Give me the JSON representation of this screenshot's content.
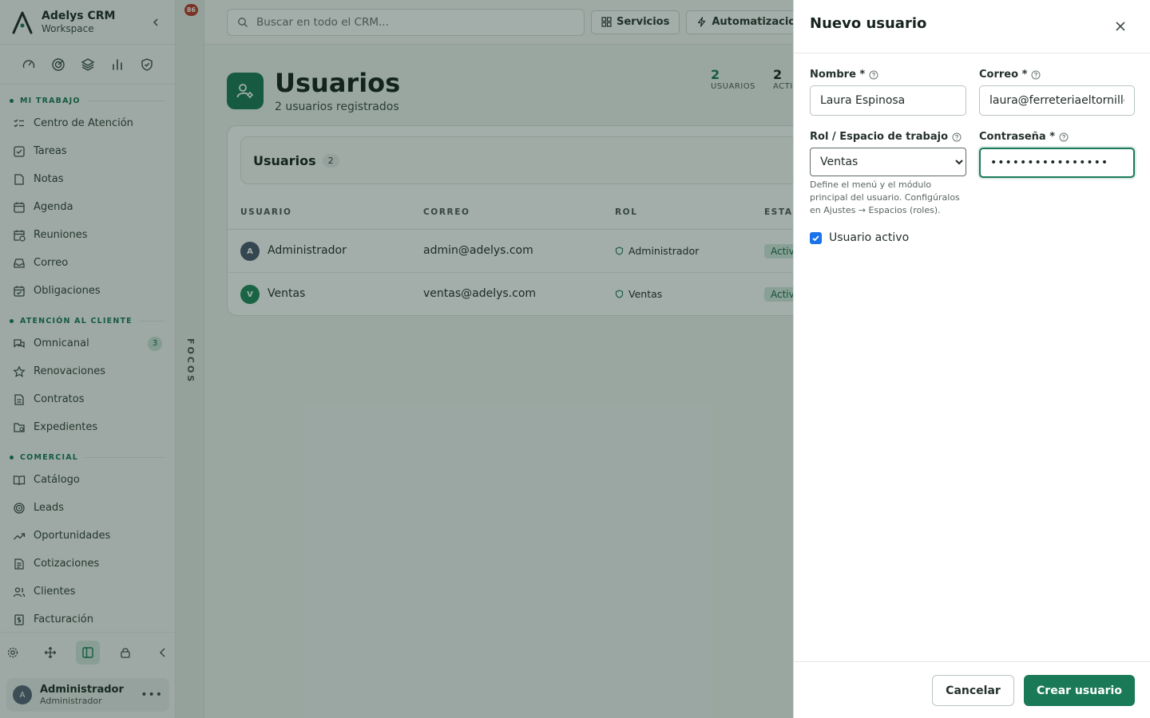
{
  "app": {
    "name": "Adelys CRM",
    "workspace": "Workspace"
  },
  "sidebar": {
    "sections": [
      {
        "label": "MI TRABAJO",
        "items": [
          {
            "label": "Centro de Atención",
            "icon": "list-check-icon"
          },
          {
            "label": "Tareas",
            "icon": "checkbox-icon"
          },
          {
            "label": "Notas",
            "icon": "note-icon"
          },
          {
            "label": "Agenda",
            "icon": "calendar-icon"
          },
          {
            "label": "Reuniones",
            "icon": "calendar-clock-icon"
          },
          {
            "label": "Correo",
            "icon": "inbox-icon"
          },
          {
            "label": "Obligaciones",
            "icon": "calendar-check-icon"
          }
        ]
      },
      {
        "label": "ATENCIÓN AL CLIENTE",
        "items": [
          {
            "label": "Omnicanal",
            "icon": "chat-icon",
            "badge": "3"
          },
          {
            "label": "Renovaciones",
            "icon": "star-icon"
          },
          {
            "label": "Contratos",
            "icon": "document-icon"
          },
          {
            "label": "Expedientes",
            "icon": "folder-icon"
          }
        ]
      },
      {
        "label": "COMERCIAL",
        "items": [
          {
            "label": "Catálogo",
            "icon": "book-icon"
          },
          {
            "label": "Leads",
            "icon": "target-icon"
          },
          {
            "label": "Oportunidades",
            "icon": "trend-icon"
          },
          {
            "label": "Cotizaciones",
            "icon": "quote-icon"
          },
          {
            "label": "Clientes",
            "icon": "users-icon"
          },
          {
            "label": "Facturación",
            "icon": "invoice-icon"
          }
        ]
      }
    ],
    "user": {
      "initial": "A",
      "name": "Administrador",
      "role": "Administrador"
    }
  },
  "focus": {
    "badge": "86",
    "label": "FOCOS"
  },
  "topbar": {
    "search_placeholder": "Buscar en todo el CRM...",
    "services_label": "Servicios",
    "automations_label": "Automatizacion"
  },
  "page": {
    "title": "Usuarios",
    "subtitle": "2 usuarios registrados",
    "stats": [
      {
        "value": "2",
        "label": "USUARIOS",
        "color": "#1a7a57"
      },
      {
        "value": "2",
        "label": "ACTI",
        "color": "#17231e"
      }
    ]
  },
  "users_table": {
    "title": "Usuarios",
    "count": "2",
    "columns": [
      "USUARIO",
      "CORREO",
      "ROL",
      "ESTA"
    ],
    "rows": [
      {
        "initial": "A",
        "name": "Administrador",
        "email": "admin@adelys.com",
        "role": "Administrador",
        "status": "Activ"
      },
      {
        "initial": "V",
        "name": "Ventas",
        "email": "ventas@adelys.com",
        "role": "Ventas",
        "status": "Activ"
      }
    ]
  },
  "drawer": {
    "title": "Nuevo usuario",
    "name_label": "Nombre *",
    "name_value": "Laura Espinosa",
    "email_label": "Correo *",
    "email_value": "laura@ferreteriaeltornillo",
    "role_label": "Rol / Espacio de trabajo",
    "role_value": "Ventas",
    "password_label": "Contraseña *",
    "password_value": "••••••••••••••••",
    "role_help": "Define el menú y el módulo principal del usuario. Configúralos en Ajustes → Espacios (roles).",
    "active_label": "Usuario activo",
    "active_checked": true,
    "cancel_label": "Cancelar",
    "create_label": "Crear usuario"
  },
  "colors": {
    "brand": "#1a7a57",
    "danger": "#c0392b"
  }
}
